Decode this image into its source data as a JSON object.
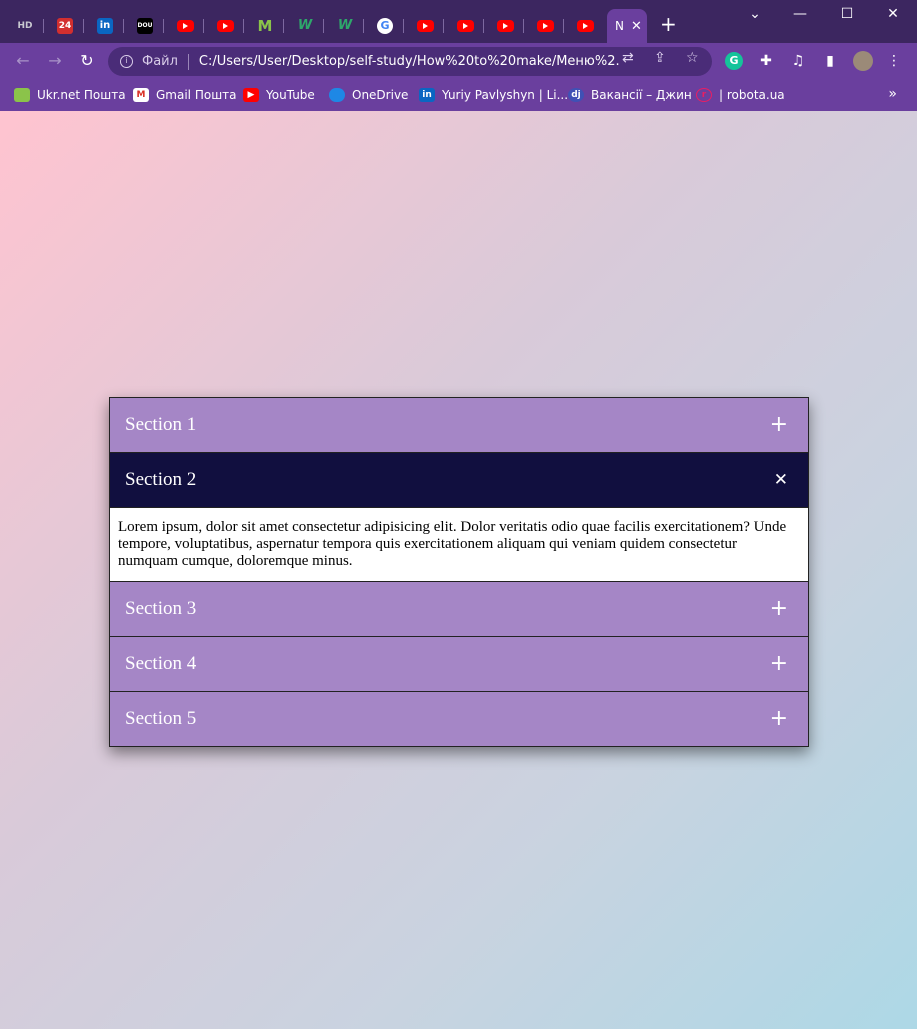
{
  "browser": {
    "tabs": [
      {
        "icon": "hd-icon",
        "label": "HD"
      },
      {
        "icon": "24-icon",
        "label": "24"
      },
      {
        "icon": "linkedin-icon",
        "label": "in"
      },
      {
        "icon": "dou-icon",
        "label": "DOU"
      },
      {
        "icon": "youtube-icon",
        "label": ""
      },
      {
        "icon": "youtube-icon",
        "label": ""
      },
      {
        "icon": "m-icon",
        "label": "M"
      },
      {
        "icon": "w-icon",
        "label": "W"
      },
      {
        "icon": "w-icon",
        "label": "W"
      },
      {
        "icon": "google-icon",
        "label": "G"
      },
      {
        "icon": "youtube-icon",
        "label": ""
      },
      {
        "icon": "youtube-icon",
        "label": ""
      },
      {
        "icon": "youtube-icon",
        "label": ""
      },
      {
        "icon": "youtube-icon",
        "label": ""
      },
      {
        "icon": "youtube-icon",
        "label": ""
      }
    ],
    "active_tab_label": "N",
    "address_scheme": "Файл",
    "address_url": "C:/Users/User/Desktop/self-study/How%20to%20make/Меню%2...",
    "bookmarks": [
      {
        "icon": "ukrnet-icon",
        "label": "Ukr.net Пошта"
      },
      {
        "icon": "gmail-icon",
        "label": "Gmail Пошта"
      },
      {
        "icon": "youtube-icon",
        "label": "YouTube"
      },
      {
        "icon": "onedrive-icon",
        "label": "OneDrive"
      },
      {
        "icon": "linkedin-icon",
        "label": "Yuriy Pavlyshyn | Li..."
      },
      {
        "icon": "djinni-icon",
        "label": "Вакансії – Джин"
      },
      {
        "icon": "robota-icon",
        "label": "| robota.ua"
      }
    ],
    "colors": {
      "tabstrip": "#3c2660",
      "toolbar": "#6a3f9e"
    }
  },
  "accordion": {
    "sections": [
      {
        "title": "Section 1",
        "toggle": "+",
        "open": false
      },
      {
        "title": "Section 2",
        "toggle": "✕",
        "open": true
      },
      {
        "title": "Section 3",
        "toggle": "+",
        "open": false
      },
      {
        "title": "Section 4",
        "toggle": "+",
        "open": false
      },
      {
        "title": "Section 5",
        "toggle": "+",
        "open": false
      }
    ],
    "open_content": "Lorem ipsum, dolor sit amet consectetur adipisicing elit. Dolor veritatis odio quae facilis exercitationem? Unde tempore, voluptatibus, aspernatur tempora quis exercitationem aliquam qui veniam quidem consectetur numquam cumque, doloremque minus.",
    "colors": {
      "header": "#a586c6",
      "header_open": "#110f3f",
      "body": "#ffffff"
    }
  }
}
